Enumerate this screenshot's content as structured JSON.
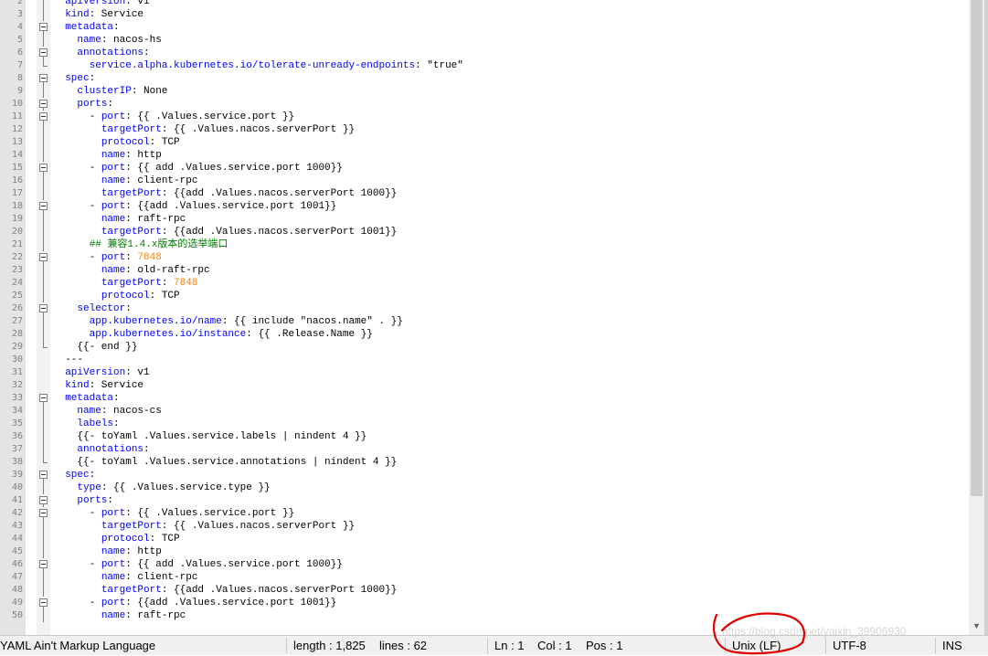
{
  "editor": {
    "lines": [
      {
        "n": "2",
        "fold": "line",
        "t": [
          [
            "  "
          ],
          [
            "apiVersion",
            "k"
          ],
          [
            ": v1"
          ]
        ]
      },
      {
        "n": "3",
        "fold": "line",
        "t": [
          [
            "  "
          ],
          [
            "kind",
            "k"
          ],
          [
            ": Service"
          ]
        ]
      },
      {
        "n": "4",
        "fold": "box",
        "t": [
          [
            "  "
          ],
          [
            "metadata",
            "k"
          ],
          [
            ":"
          ]
        ]
      },
      {
        "n": "5",
        "fold": "line",
        "t": [
          [
            "    "
          ],
          [
            "name",
            "k"
          ],
          [
            ": nacos-hs"
          ]
        ]
      },
      {
        "n": "6",
        "fold": "box",
        "t": [
          [
            "    "
          ],
          [
            "annotations",
            "k"
          ],
          [
            ":"
          ]
        ]
      },
      {
        "n": "7",
        "fold": "end",
        "t": [
          [
            "      "
          ],
          [
            "service.alpha.kubernetes.io/tolerate-unready-endpoints",
            "k"
          ],
          [
            ": \"true\""
          ]
        ]
      },
      {
        "n": "8",
        "fold": "box",
        "t": [
          [
            "  "
          ],
          [
            "spec",
            "k"
          ],
          [
            ":"
          ]
        ]
      },
      {
        "n": "9",
        "fold": "line",
        "t": [
          [
            "    "
          ],
          [
            "clusterIP",
            "k"
          ],
          [
            ": None"
          ]
        ]
      },
      {
        "n": "10",
        "fold": "box",
        "t": [
          [
            "    "
          ],
          [
            "ports",
            "k"
          ],
          [
            ":"
          ]
        ]
      },
      {
        "n": "11",
        "fold": "box",
        "t": [
          [
            "      - "
          ],
          [
            "port",
            "k"
          ],
          [
            ": {{ .Values.service.port }}"
          ]
        ]
      },
      {
        "n": "12",
        "fold": "line",
        "t": [
          [
            "        "
          ],
          [
            "targetPort",
            "k"
          ],
          [
            ": {{ .Values.nacos.serverPort }}"
          ]
        ]
      },
      {
        "n": "13",
        "fold": "line",
        "t": [
          [
            "        "
          ],
          [
            "protocol",
            "k"
          ],
          [
            ": TCP"
          ]
        ]
      },
      {
        "n": "14",
        "fold": "line",
        "t": [
          [
            "        "
          ],
          [
            "name",
            "k"
          ],
          [
            ": http"
          ]
        ]
      },
      {
        "n": "15",
        "fold": "box",
        "t": [
          [
            "      - "
          ],
          [
            "port",
            "k"
          ],
          [
            ": {{ add .Values.service.port 1000}}"
          ]
        ]
      },
      {
        "n": "16",
        "fold": "line",
        "t": [
          [
            "        "
          ],
          [
            "name",
            "k"
          ],
          [
            ": client-rpc"
          ]
        ]
      },
      {
        "n": "17",
        "fold": "line",
        "t": [
          [
            "        "
          ],
          [
            "targetPort",
            "k"
          ],
          [
            ": {{add .Values.nacos.serverPort 1000}}"
          ]
        ]
      },
      {
        "n": "18",
        "fold": "box",
        "t": [
          [
            "      - "
          ],
          [
            "port",
            "k"
          ],
          [
            ": {{add .Values.service.port 1001}}"
          ]
        ]
      },
      {
        "n": "19",
        "fold": "line",
        "t": [
          [
            "        "
          ],
          [
            "name",
            "k"
          ],
          [
            ": raft-rpc"
          ]
        ]
      },
      {
        "n": "20",
        "fold": "line",
        "t": [
          [
            "        "
          ],
          [
            "targetPort",
            "k"
          ],
          [
            ": {{add .Values.nacos.serverPort 1001}}"
          ]
        ]
      },
      {
        "n": "21",
        "fold": "line",
        "t": [
          [
            "      "
          ],
          [
            "## 兼容1.4.x版本的选举端口",
            "c"
          ]
        ]
      },
      {
        "n": "22",
        "fold": "box",
        "t": [
          [
            "      - "
          ],
          [
            "port",
            "k"
          ],
          [
            ": "
          ],
          [
            "7848",
            "n"
          ]
        ]
      },
      {
        "n": "23",
        "fold": "line",
        "t": [
          [
            "        "
          ],
          [
            "name",
            "k"
          ],
          [
            ": old-raft-rpc"
          ]
        ]
      },
      {
        "n": "24",
        "fold": "line",
        "t": [
          [
            "        "
          ],
          [
            "targetPort",
            "k"
          ],
          [
            ": "
          ],
          [
            "7848",
            "n"
          ]
        ]
      },
      {
        "n": "25",
        "fold": "line",
        "t": [
          [
            "        "
          ],
          [
            "protocol",
            "k"
          ],
          [
            ": TCP"
          ]
        ]
      },
      {
        "n": "26",
        "fold": "box",
        "t": [
          [
            "    "
          ],
          [
            "selector",
            "k"
          ],
          [
            ":"
          ]
        ]
      },
      {
        "n": "27",
        "fold": "line",
        "t": [
          [
            "      "
          ],
          [
            "app.kubernetes.io/name",
            "k"
          ],
          [
            ": {{ include \"nacos.name\" . }}"
          ]
        ]
      },
      {
        "n": "28",
        "fold": "line",
        "t": [
          [
            "      "
          ],
          [
            "app.kubernetes.io/instance",
            "k"
          ],
          [
            ": {{ .Release.Name }}"
          ]
        ]
      },
      {
        "n": "29",
        "fold": "end",
        "t": [
          [
            "    {{- end }}"
          ]
        ]
      },
      {
        "n": "30",
        "fold": "none",
        "t": [
          [
            "  ---"
          ]
        ]
      },
      {
        "n": "31",
        "fold": "none",
        "t": [
          [
            "  "
          ],
          [
            "apiVersion",
            "k"
          ],
          [
            ": v1"
          ]
        ]
      },
      {
        "n": "32",
        "fold": "none",
        "t": [
          [
            "  "
          ],
          [
            "kind",
            "k"
          ],
          [
            ": Service"
          ]
        ]
      },
      {
        "n": "33",
        "fold": "box",
        "t": [
          [
            "  "
          ],
          [
            "metadata",
            "k"
          ],
          [
            ":"
          ]
        ]
      },
      {
        "n": "34",
        "fold": "line",
        "t": [
          [
            "    "
          ],
          [
            "name",
            "k"
          ],
          [
            ": nacos-cs"
          ]
        ]
      },
      {
        "n": "35",
        "fold": "line",
        "t": [
          [
            "    "
          ],
          [
            "labels",
            "k"
          ],
          [
            ":"
          ]
        ]
      },
      {
        "n": "36",
        "fold": "line",
        "t": [
          [
            "    {{- toYaml .Values.service.labels | nindent 4 }}"
          ]
        ]
      },
      {
        "n": "37",
        "fold": "line",
        "t": [
          [
            "    "
          ],
          [
            "annotations",
            "k"
          ],
          [
            ":"
          ]
        ]
      },
      {
        "n": "38",
        "fold": "end",
        "t": [
          [
            "    {{- toYaml .Values.service.annotations | nindent 4 }}"
          ]
        ]
      },
      {
        "n": "39",
        "fold": "box",
        "t": [
          [
            "  "
          ],
          [
            "spec",
            "k"
          ],
          [
            ":"
          ]
        ]
      },
      {
        "n": "40",
        "fold": "line",
        "t": [
          [
            "    "
          ],
          [
            "type",
            "k"
          ],
          [
            ": {{ .Values.service.type }}"
          ]
        ]
      },
      {
        "n": "41",
        "fold": "box",
        "t": [
          [
            "    "
          ],
          [
            "ports",
            "k"
          ],
          [
            ":"
          ]
        ]
      },
      {
        "n": "42",
        "fold": "box",
        "t": [
          [
            "      - "
          ],
          [
            "port",
            "k"
          ],
          [
            ": {{ .Values.service.port }}"
          ]
        ]
      },
      {
        "n": "43",
        "fold": "line",
        "t": [
          [
            "        "
          ],
          [
            "targetPort",
            "k"
          ],
          [
            ": {{ .Values.nacos.serverPort }}"
          ]
        ]
      },
      {
        "n": "44",
        "fold": "line",
        "t": [
          [
            "        "
          ],
          [
            "protocol",
            "k"
          ],
          [
            ": TCP"
          ]
        ]
      },
      {
        "n": "45",
        "fold": "line",
        "t": [
          [
            "        "
          ],
          [
            "name",
            "k"
          ],
          [
            ": http"
          ]
        ]
      },
      {
        "n": "46",
        "fold": "box",
        "t": [
          [
            "      - "
          ],
          [
            "port",
            "k"
          ],
          [
            ": {{ add .Values.service.port 1000}}"
          ]
        ]
      },
      {
        "n": "47",
        "fold": "line",
        "t": [
          [
            "        "
          ],
          [
            "name",
            "k"
          ],
          [
            ": client-rpc"
          ]
        ]
      },
      {
        "n": "48",
        "fold": "line",
        "t": [
          [
            "        "
          ],
          [
            "targetPort",
            "k"
          ],
          [
            ": {{add .Values.nacos.serverPort 1000}}"
          ]
        ]
      },
      {
        "n": "49",
        "fold": "box",
        "t": [
          [
            "      - "
          ],
          [
            "port",
            "k"
          ],
          [
            ": {{add .Values.service.port 1001}}"
          ]
        ]
      },
      {
        "n": "50",
        "fold": "line",
        "t": [
          [
            "        "
          ],
          [
            "name",
            "k"
          ],
          [
            ": raft-rpc"
          ]
        ]
      }
    ]
  },
  "status": {
    "language": "YAML Ain't Markup Language",
    "length": "length : 1,825",
    "lines": "lines : 62",
    "ln": "Ln : 1",
    "col": "Col : 1",
    "pos": "Pos : 1",
    "eol": "Unix (LF)",
    "encoding": "UTF-8",
    "mode": "INS"
  },
  "watermark": "https://blog.csdn.net/yaixin_39906930",
  "colors": {
    "keyword": "#0000ff",
    "number": "#ff8000",
    "comment": "#008000",
    "annotation": "#e00000"
  }
}
